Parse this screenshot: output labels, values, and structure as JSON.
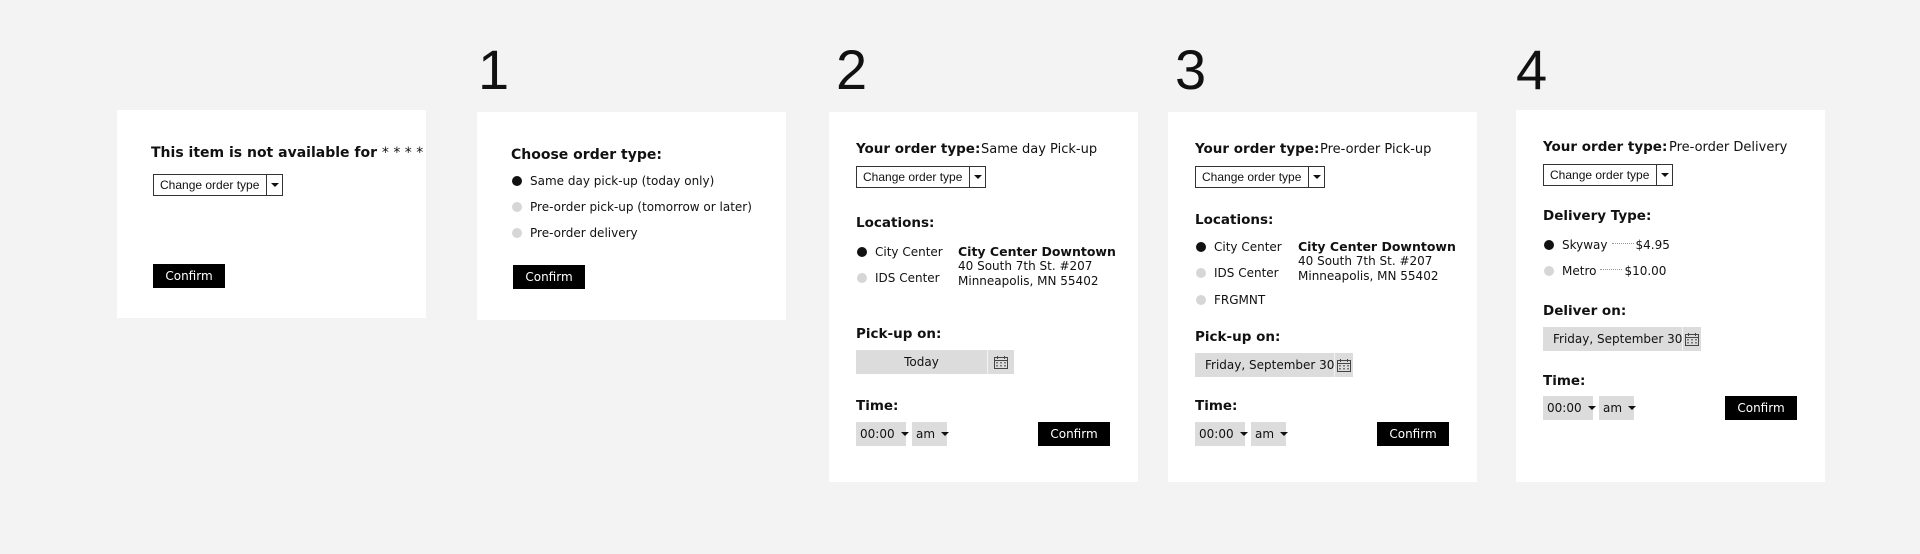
{
  "step_numbers": [
    "1",
    "2",
    "3",
    "4"
  ],
  "card0": {
    "title": "This item is not available for",
    "stars": "* * * *",
    "select": "Change order type",
    "confirm": "Confirm"
  },
  "card1": {
    "title": "Choose order type:",
    "options": [
      "Same day pick-up (today only)",
      "Pre-order pick-up (tomorrow or later)",
      "Pre-order delivery"
    ],
    "confirm": "Confirm"
  },
  "card2": {
    "order_label": "Your order type:",
    "order_value": "Same day Pick-up",
    "select": "Change order type",
    "locations_label": "Locations:",
    "locations": [
      "City Center",
      "IDS Center"
    ],
    "address": {
      "name": "City Center Downtown",
      "line1": "40 South 7th St. #207",
      "line2": "Minneapolis, MN 55402"
    },
    "pickup_label": "Pick-up on:",
    "pickup_value": "Today",
    "time_label": "Time:",
    "time": "00:00",
    "ampm": "am",
    "confirm": "Confirm"
  },
  "card3": {
    "order_label": "Your order type:",
    "order_value": "Pre-order Pick-up",
    "select": "Change order type",
    "locations_label": "Locations:",
    "locations": [
      "City Center",
      "IDS Center",
      "FRGMNT"
    ],
    "address": {
      "name": "City Center Downtown",
      "line1": "40 South 7th St. #207",
      "line2": "Minneapolis, MN 55402"
    },
    "pickup_label": "Pick-up on:",
    "pickup_value": "Friday, September 30",
    "time_label": "Time:",
    "time": "00:00",
    "ampm": "am",
    "confirm": "Confirm"
  },
  "card4": {
    "order_label": "Your order type:",
    "order_value": "Pre-order Delivery",
    "select": "Change order type",
    "delivery_label": "Delivery Type:",
    "delivery_options": [
      {
        "name": "Skyway",
        "price": "$4.95"
      },
      {
        "name": "Metro",
        "price": "$10.00"
      }
    ],
    "deliver_label": "Deliver on:",
    "deliver_value": "Friday, September 30",
    "time_label": "Time:",
    "time": "00:00",
    "ampm": "am",
    "confirm": "Confirm"
  },
  "icons": {
    "dropdown": "chevron-down-icon",
    "calendar": "calendar-icon",
    "radio": "radio-icon"
  },
  "colors": {
    "background": "#f3f3f3",
    "card": "#ffffff",
    "button": "#000000",
    "field": "#dcdcdc",
    "radio_selected": "#111111",
    "radio_unselected": "#d6d6d6"
  }
}
